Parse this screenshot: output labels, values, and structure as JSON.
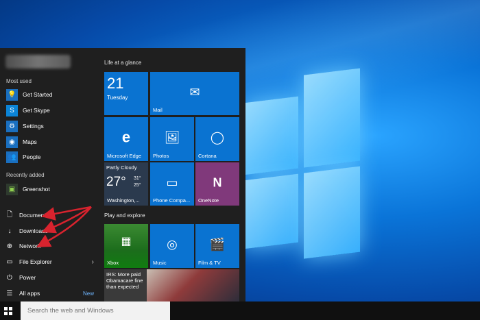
{
  "start_menu": {
    "most_used_header": "Most used",
    "most_used": [
      {
        "label": "Get Started",
        "icon": "lightbulb-icon"
      },
      {
        "label": "Get Skype",
        "icon": "skype-icon"
      },
      {
        "label": "Settings",
        "icon": "gear-icon"
      },
      {
        "label": "Maps",
        "icon": "camera-icon"
      },
      {
        "label": "People",
        "icon": "people-icon"
      }
    ],
    "recently_added_header": "Recently added",
    "recently_added": [
      {
        "label": "Greenshot",
        "icon": "greenshot-icon"
      }
    ],
    "places": [
      {
        "label": "Documents",
        "icon": "document-icon"
      },
      {
        "label": "Downloads",
        "icon": "download-icon"
      },
      {
        "label": "Network",
        "icon": "network-icon"
      },
      {
        "label": "File Explorer",
        "icon": "file-explorer-icon"
      },
      {
        "label": "Power",
        "icon": "power-icon"
      },
      {
        "label": "All apps",
        "icon": "all-apps-icon"
      }
    ],
    "new_badge": "New"
  },
  "tiles": {
    "group1": "Life at a glance",
    "group2": "Play and explore",
    "calendar": {
      "day": "21",
      "weekday": "Tuesday"
    },
    "mail": "Mail",
    "edge": "Microsoft Edge",
    "photos": "Photos",
    "cortana": "Cortana",
    "weather": {
      "condition": "Partly Cloudy",
      "temp": "27°",
      "high": "31°",
      "low": "25°",
      "city": "Washington,..."
    },
    "phone": "Phone Compa...",
    "onenote": "OneNote",
    "xbox": "Xbox",
    "music": "Music",
    "film": "Film & TV",
    "news": "IRS: More paid Obamacare fine than expected"
  },
  "taskbar": {
    "search_placeholder": "Search the web and Windows"
  },
  "colors": {
    "tile_blue": "#0a73d1",
    "onenote_purple": "#80397b",
    "xbox_green": "#107c10",
    "annotation_red": "#d9232e",
    "menu_bg": "#1f1f1f"
  }
}
